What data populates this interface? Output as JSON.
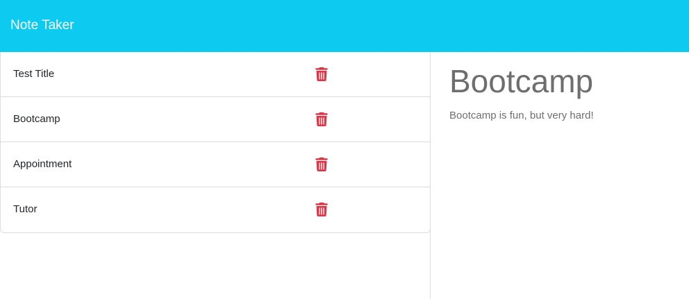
{
  "navbar": {
    "brand": "Note Taker",
    "background_color": "#0dcaf0"
  },
  "notes": [
    {
      "title": "Test Title",
      "delete_icon": "trash-icon"
    },
    {
      "title": "Bootcamp",
      "delete_icon": "trash-icon"
    },
    {
      "title": "Appointment",
      "delete_icon": "trash-icon"
    },
    {
      "title": "Tutor",
      "delete_icon": "trash-icon"
    }
  ],
  "active_note": {
    "title": "Bootcamp",
    "text": "Bootcamp is fun, but very hard!"
  },
  "colors": {
    "accent": "#0dcaf0",
    "delete": "#dc3545",
    "muted_text": "#6e6e6e"
  }
}
